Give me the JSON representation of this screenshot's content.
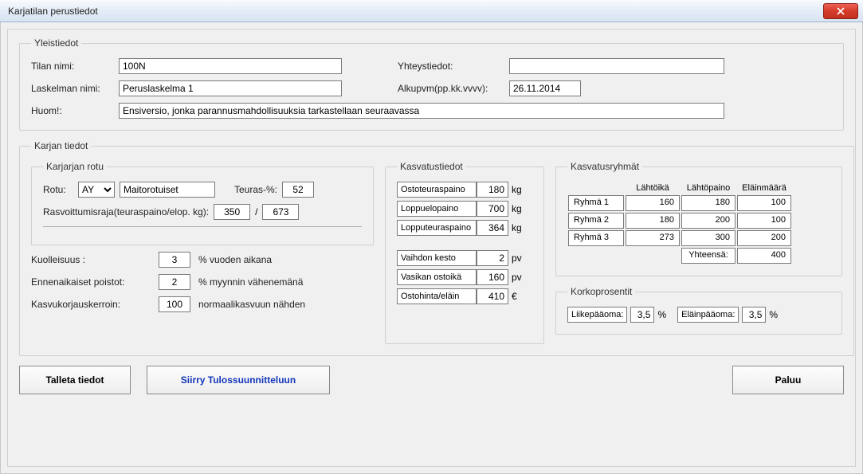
{
  "window": {
    "title": "Karjatilan perustiedot"
  },
  "yleis": {
    "legend": "Yleistiedot",
    "tila_nimi_label": "Tilan nimi:",
    "tila_nimi": "100N",
    "laskelma_nimi_label": "Laskelman  nimi:",
    "laskelma_nimi": "Peruslaskelma 1",
    "yhteystiedot_label": "Yhteystiedot:",
    "yhteystiedot": "",
    "alkupvm_label": "Alkupvm(pp.kk.vvvv):",
    "alkupvm": "26.11.2014",
    "huom_label": "Huom!:",
    "huom": "Ensiversio, jonka parannusmahdollisuuksia tarkastellaan seuraavassa"
  },
  "karja": {
    "legend": "Karjan tiedot",
    "rotu_legend": "Karjarjan rotu",
    "rotu_label": "Rotu:",
    "rotu_sel": "AY",
    "rotu_desc": "Maitorotuiset",
    "teuras_label": "Teuras-%:",
    "teuras_pct": "52",
    "rasvo_label": "Rasvoittumisraja(teuraspaino/elop. kg):",
    "rasvo_a": "350",
    "rasvo_sep": "/",
    "rasvo_b": "673",
    "kuolleisuus_label": "Kuolleisuus :",
    "kuolleisuus": "3",
    "kuolleisuus_suffix": "% vuoden aikana",
    "ennenaik_label": "Ennenaikaiset poistot:",
    "ennenaik": "2",
    "ennenaik_suffix": "% myynnin vähenemänä",
    "kasvukorj_label": "Kasvukorjauskerroin:",
    "kasvukorj": "100",
    "kasvukorj_suffix": "normaalikasvuun nähden"
  },
  "kasvatus": {
    "legend": "Kasvatustiedot",
    "ostoteuras_label": "Ostoteuraspaino",
    "ostoteuras": "180",
    "loppuelo_label": "Loppuelopaino",
    "loppuelo": "700",
    "lopputeuras_label": "Lopputeuraspaino",
    "lopputeuras": "364",
    "vaihdon_label": "Vaihdon kesto",
    "vaihdon": "2",
    "vasikan_label": "Vasikan ostoikä",
    "vasikan": "160",
    "ostohinta_label": "Ostohinta/eläin",
    "ostohinta": "410",
    "kg": "kg",
    "pv": "pv",
    "eur": "€"
  },
  "ryhmat": {
    "legend": "Kasvatusryhmät",
    "hdr_lahtoika": "Lähtöikä",
    "hdr_lahtopaino": "Lähtöpaino",
    "hdr_elainmaara": "Eläinmäärä",
    "rows": [
      {
        "name": "Ryhmä 1",
        "lahtoika": "160",
        "lahtopaino": "180",
        "elainmaara": "100"
      },
      {
        "name": "Ryhmä 2",
        "lahtoika": "180",
        "lahtopaino": "200",
        "elainmaara": "100"
      },
      {
        "name": "Ryhmä 3",
        "lahtoika": "273",
        "lahtopaino": "300",
        "elainmaara": "200"
      }
    ],
    "total_label": "Yhteensä:",
    "total": "400"
  },
  "korko": {
    "legend": "Korkoprosentit",
    "liike_label": "Liikepääoma:",
    "liike": "3,5",
    "elain_label": "Eläinpääoma:",
    "elain": "3,5",
    "pct": "%"
  },
  "buttons": {
    "talleta": "Talleta tiedot",
    "siirry": "Siirry Tulossuunnitteluun",
    "paluu": "Paluu"
  }
}
